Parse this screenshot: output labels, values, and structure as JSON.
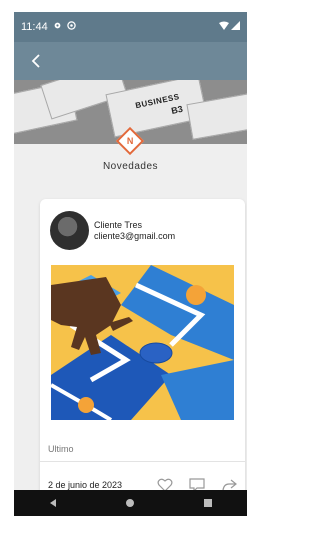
{
  "status_bar": {
    "time": "11:44",
    "icons": [
      "settings-icon",
      "circle-icon",
      "wifi-icon",
      "signal-icon"
    ]
  },
  "app_bar": {
    "back_icon": "chevron-left-icon"
  },
  "banner": {
    "visible_text": [
      "BUSINESS",
      "B3"
    ]
  },
  "section": {
    "title": "Novedades",
    "logo_letter": "N"
  },
  "post": {
    "user_name": "Cliente Tres",
    "user_email": "cliente3@gmail.com",
    "caption": "Ultimo",
    "date": "2 de junio de 2023",
    "actions": [
      "heart-icon",
      "comment-icon",
      "share-icon"
    ]
  },
  "nav": {
    "buttons": [
      "back-triangle-icon",
      "home-circle-icon",
      "recents-square-icon"
    ]
  },
  "colors": {
    "status_bar": "#5f7a8b",
    "app_bar": "#6e8898",
    "accent": "#e2693b",
    "background": "#efefef",
    "card": "#ffffff",
    "nav_bar": "#111111"
  }
}
